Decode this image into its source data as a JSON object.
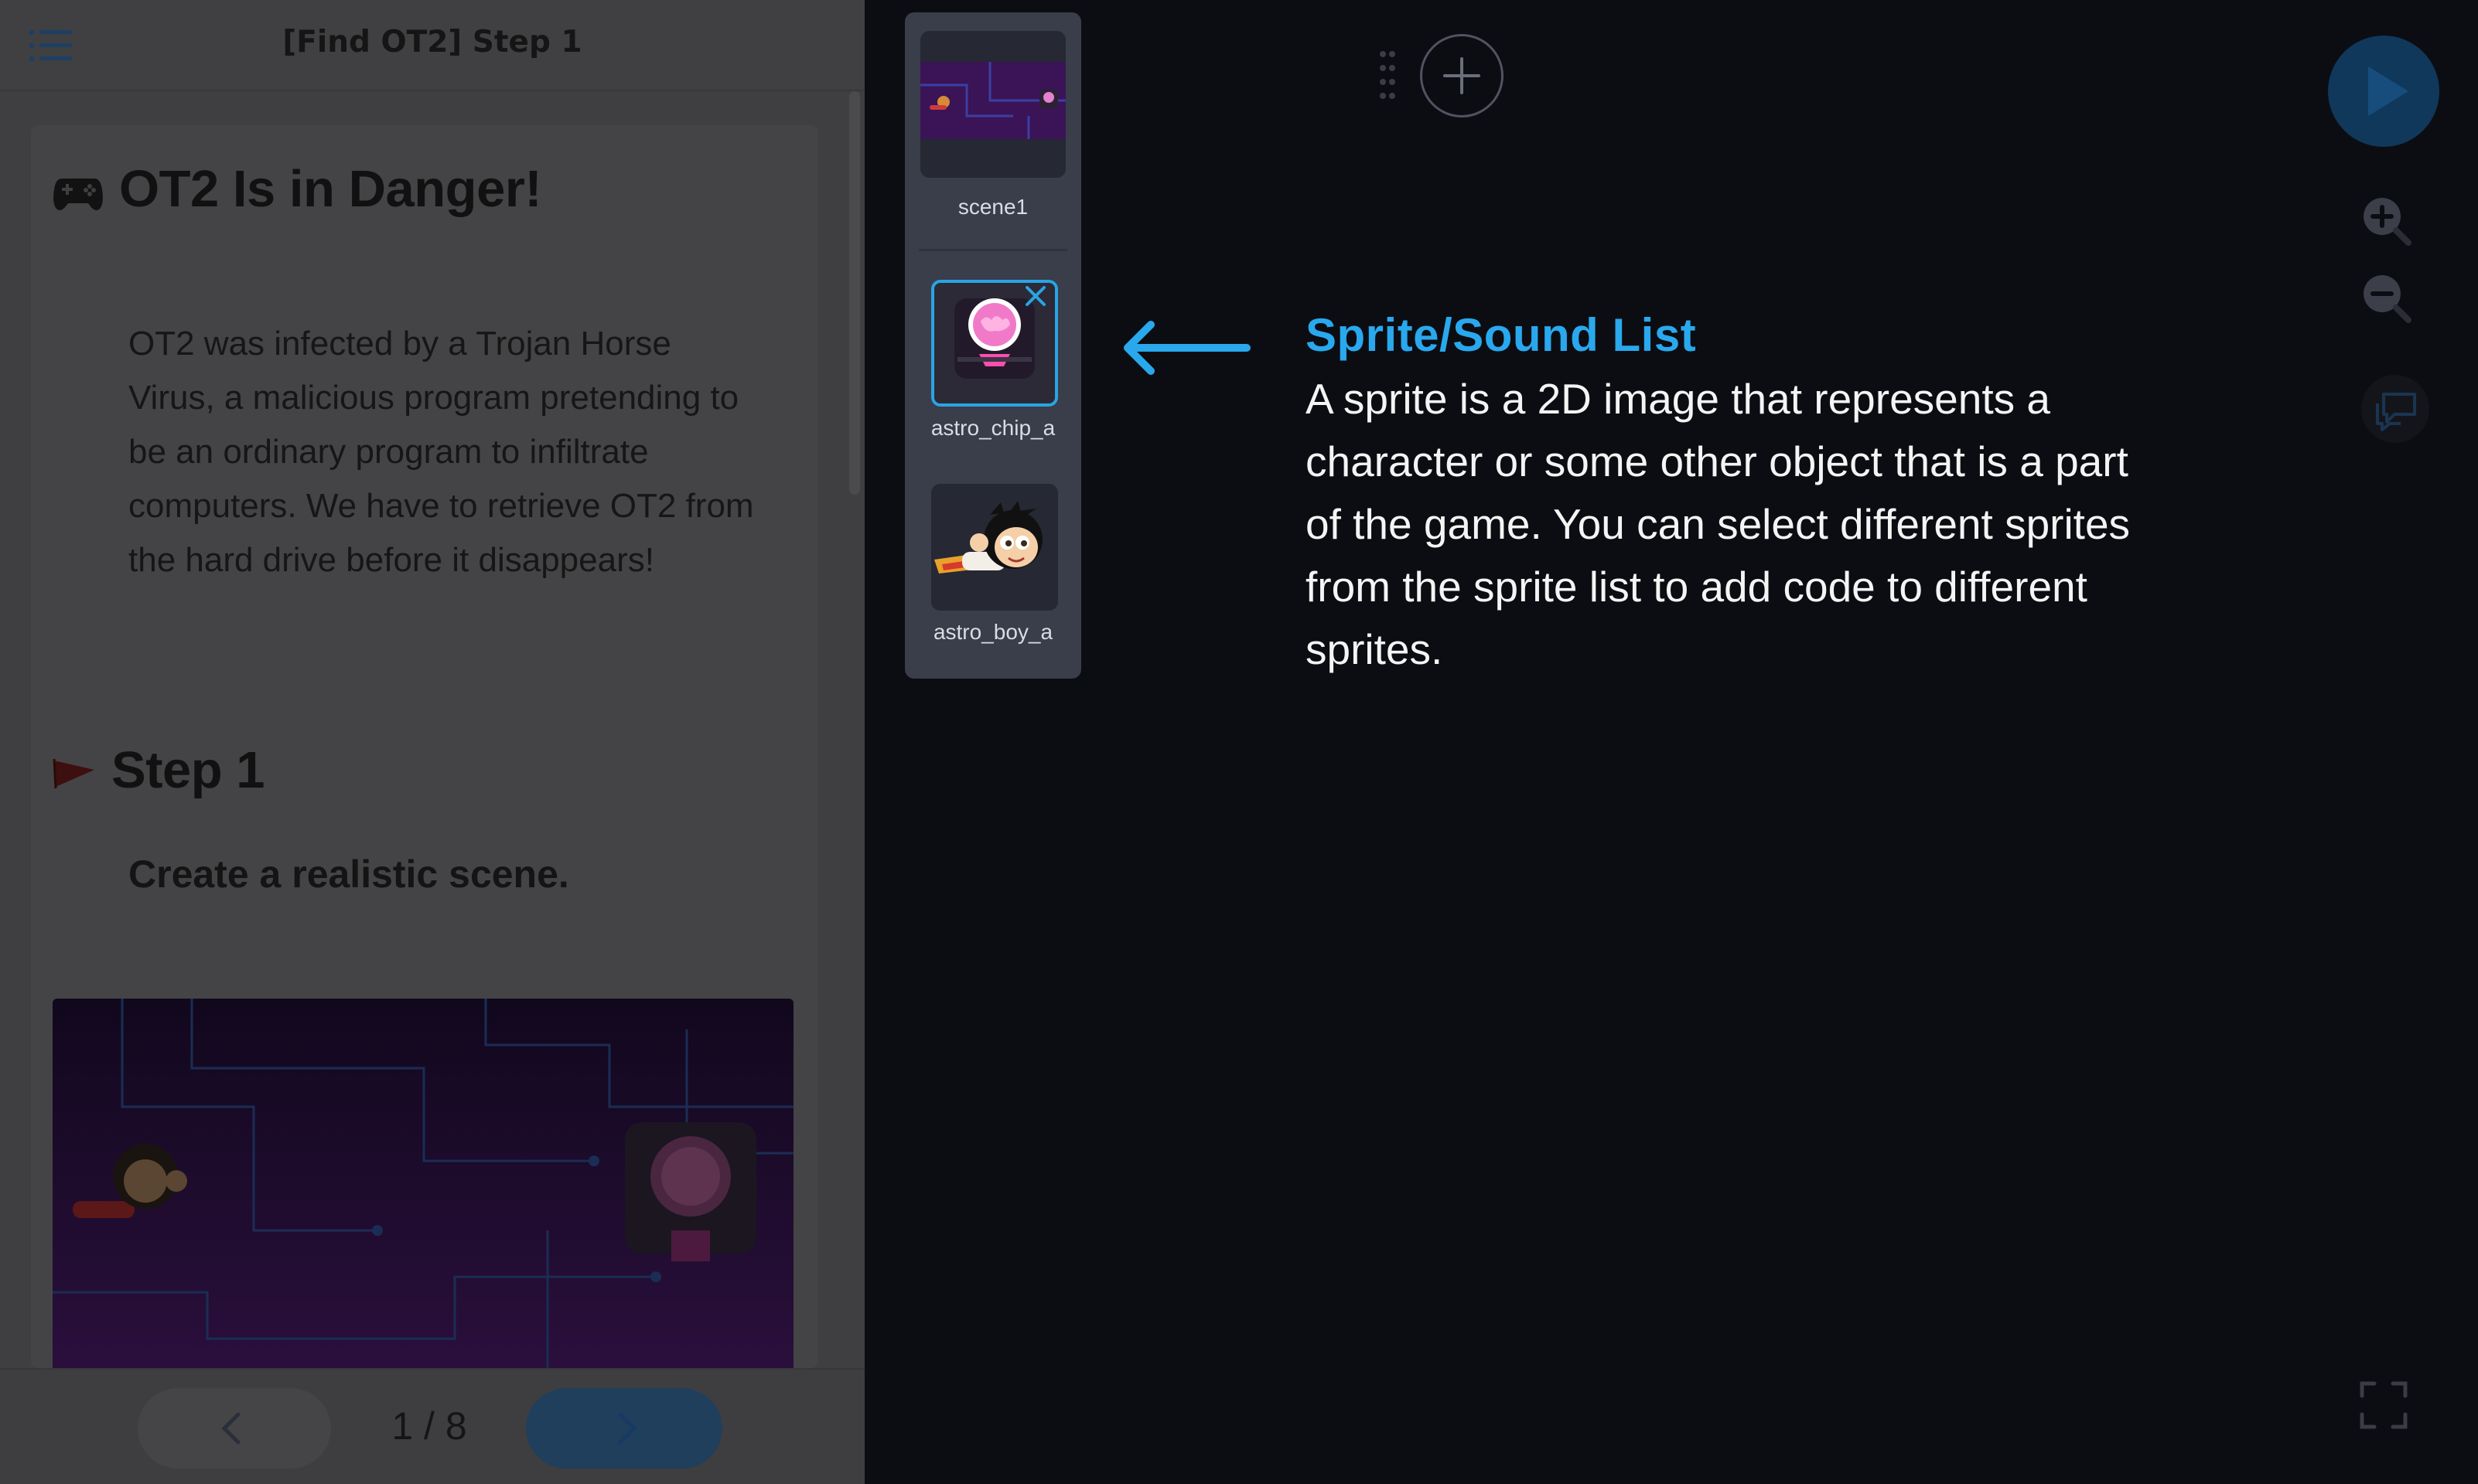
{
  "lesson": {
    "title": "[Find OT2] Step 1",
    "heading": "OT2 Is in Danger!",
    "intro": "OT2 was infected by a Trojan Horse Virus, a malicious program pretending to be an ordinary program to infiltrate computers. We have to retrieve OT2 from the hard drive before it disappears!",
    "step_heading": "Step 1",
    "step_text": "Create a realistic scene.",
    "page_indicator": "1 / 8"
  },
  "sprite_list": {
    "items": [
      {
        "name": "scene1",
        "selected": false
      },
      {
        "name": "astro_chip_a",
        "selected": true
      },
      {
        "name": "astro_boy_a",
        "selected": false
      }
    ]
  },
  "annotation": {
    "title": "Sprite/Sound List",
    "body": "A sprite is a 2D image that represents a character or some other object that is a part of the game. You can select different sprites from the sprite list to add code to different sprites."
  },
  "colors": {
    "accent": "#29a8ee",
    "run_button": "#10385a",
    "workspace": "#0c0d12",
    "panel_overlay": "#3f3f41"
  },
  "icons": [
    "list-menu-icon",
    "gamepad-icon",
    "flag-icon",
    "chevron-left-icon",
    "chevron-right-icon",
    "close-icon",
    "drag-handle-icon",
    "plus-icon",
    "play-icon",
    "zoom-in-icon",
    "zoom-out-icon",
    "help-chat-icon",
    "fullscreen-icon",
    "arrow-left-icon"
  ]
}
